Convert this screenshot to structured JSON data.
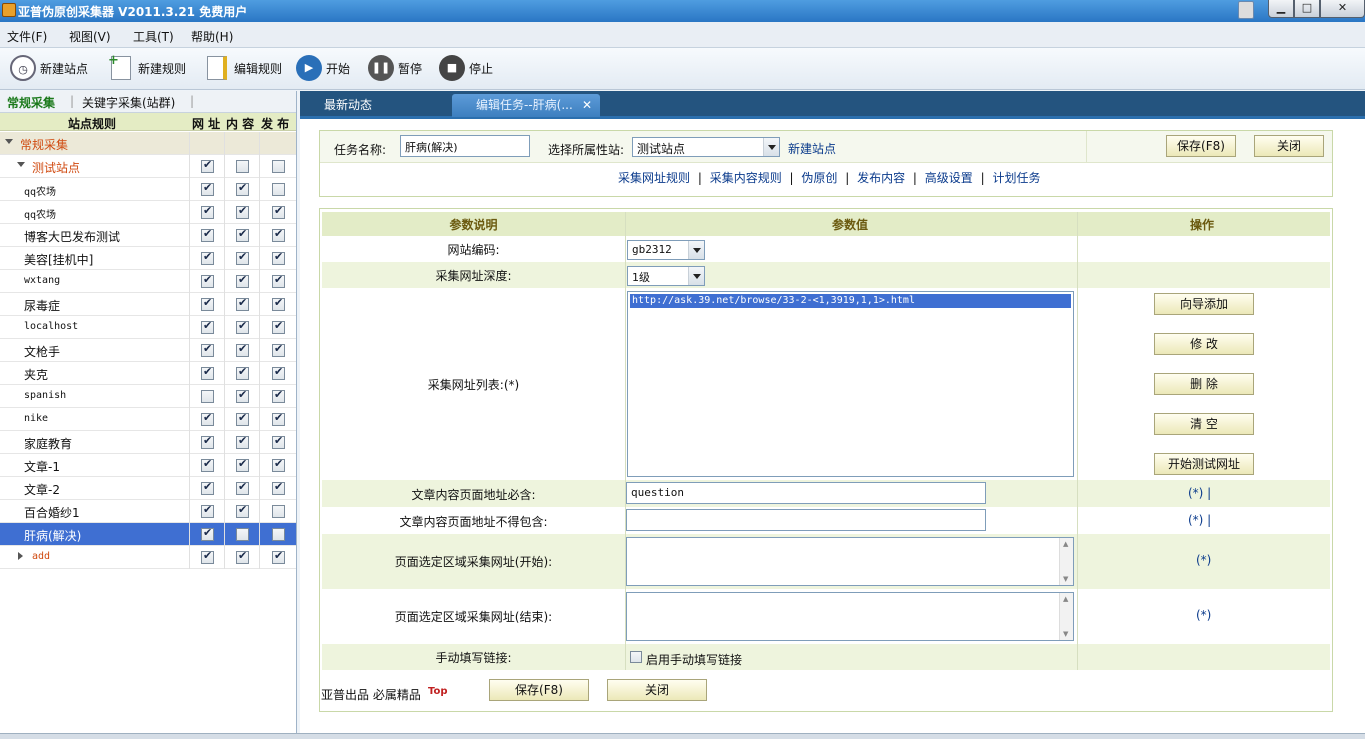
{
  "window": {
    "title": "亚普伪原创采集器 V2011.3.21 免费用户"
  },
  "menu": [
    "文件(F)",
    "视图(V)",
    "工具(T)",
    "帮助(H)"
  ],
  "toolbar": {
    "new_site": "新建站点",
    "new_rule": "新建规则",
    "edit_rule": "编辑规则",
    "start": "开始",
    "pause": "暂停",
    "stop": "停止"
  },
  "left": {
    "tabs": [
      "常规采集",
      "关键字采集(站群)"
    ],
    "header": {
      "rules": "站点规则",
      "c1": "网 址",
      "c2": "内 容",
      "c3": "发 布"
    },
    "rows": [
      {
        "label": "常规采集",
        "checks": []
      },
      {
        "label": "测试站点",
        "checks": [
          true,
          false,
          false
        ]
      },
      {
        "label": "qq农场",
        "checks": [
          true,
          true,
          false
        ]
      },
      {
        "label": "qq农场",
        "checks": [
          true,
          true,
          true
        ]
      },
      {
        "label": "博客大巴发布测试",
        "checks": [
          true,
          true,
          true
        ]
      },
      {
        "label": "美容[挂机中]",
        "checks": [
          true,
          true,
          true
        ]
      },
      {
        "label": "wxtang",
        "checks": [
          true,
          true,
          true
        ]
      },
      {
        "label": "尿毒症",
        "checks": [
          true,
          true,
          true
        ]
      },
      {
        "label": "localhost",
        "checks": [
          true,
          true,
          true
        ]
      },
      {
        "label": "文枪手",
        "checks": [
          true,
          true,
          true
        ]
      },
      {
        "label": "夹克",
        "checks": [
          true,
          true,
          true
        ]
      },
      {
        "label": "spanish",
        "checks": [
          false,
          true,
          true
        ]
      },
      {
        "label": "nike",
        "checks": [
          true,
          true,
          true
        ]
      },
      {
        "label": "家庭教育",
        "checks": [
          true,
          true,
          true
        ]
      },
      {
        "label": "文章-1",
        "checks": [
          true,
          true,
          true
        ]
      },
      {
        "label": "文章-2",
        "checks": [
          true,
          true,
          true
        ]
      },
      {
        "label": "百合婚纱1",
        "checks": [
          true,
          true,
          false
        ]
      },
      {
        "label": "肝病(解决)",
        "checks": [
          true,
          false,
          false
        ]
      },
      {
        "label": "add",
        "checks": [
          true,
          true,
          true
        ]
      }
    ]
  },
  "doc_tabs": [
    "最新动态",
    "编辑任务--肝病(..."
  ],
  "task": {
    "name_label": "任务名称:",
    "name_value": "肝病(解决)",
    "site_label": "选择所属性站:",
    "site_value": "测试站点",
    "new_site_link": "新建站点",
    "save": "保存(F8)",
    "close": "关闭"
  },
  "subnav": [
    "采集网址规则",
    "采集内容规则",
    "伪原创",
    "发布内容",
    "高级设置",
    "计划任务"
  ],
  "params": {
    "header": {
      "desc": "参数说明",
      "value": "参数值",
      "op": "操作"
    },
    "encoding_label": "网站编码:",
    "encoding_value": "gb2312",
    "depth_label": "采集网址深度:",
    "depth_value": "1级",
    "urllist_label": "采集网址列表:(*)",
    "urllist_items": [
      "http://ask.39.net/browse/33-2-<1,3919,1,1>.html"
    ],
    "buttons": [
      "向导添加",
      "修 改",
      "删 除",
      "清 空",
      "开始测试网址"
    ],
    "must_contain_label": "文章内容页面地址必含:",
    "must_contain_value": "question",
    "must_contain_op": "(*) |",
    "not_contain_label": "文章内容页面地址不得包含:",
    "not_contain_value": "",
    "not_contain_op": "(*) |",
    "region_start_label": "页面选定区域采集网址(开始):",
    "region_start_op": "(*)",
    "region_end_label": "页面选定区域采集网址(结束):",
    "region_end_op": "(*)",
    "manual_label": "手动填写链接:",
    "manual_checkbox": "启用手动填写链接"
  },
  "footer": {
    "brand": "亚普出品 必属精品",
    "top_link": "Top",
    "save": "保存(F8)",
    "close": "关闭"
  }
}
